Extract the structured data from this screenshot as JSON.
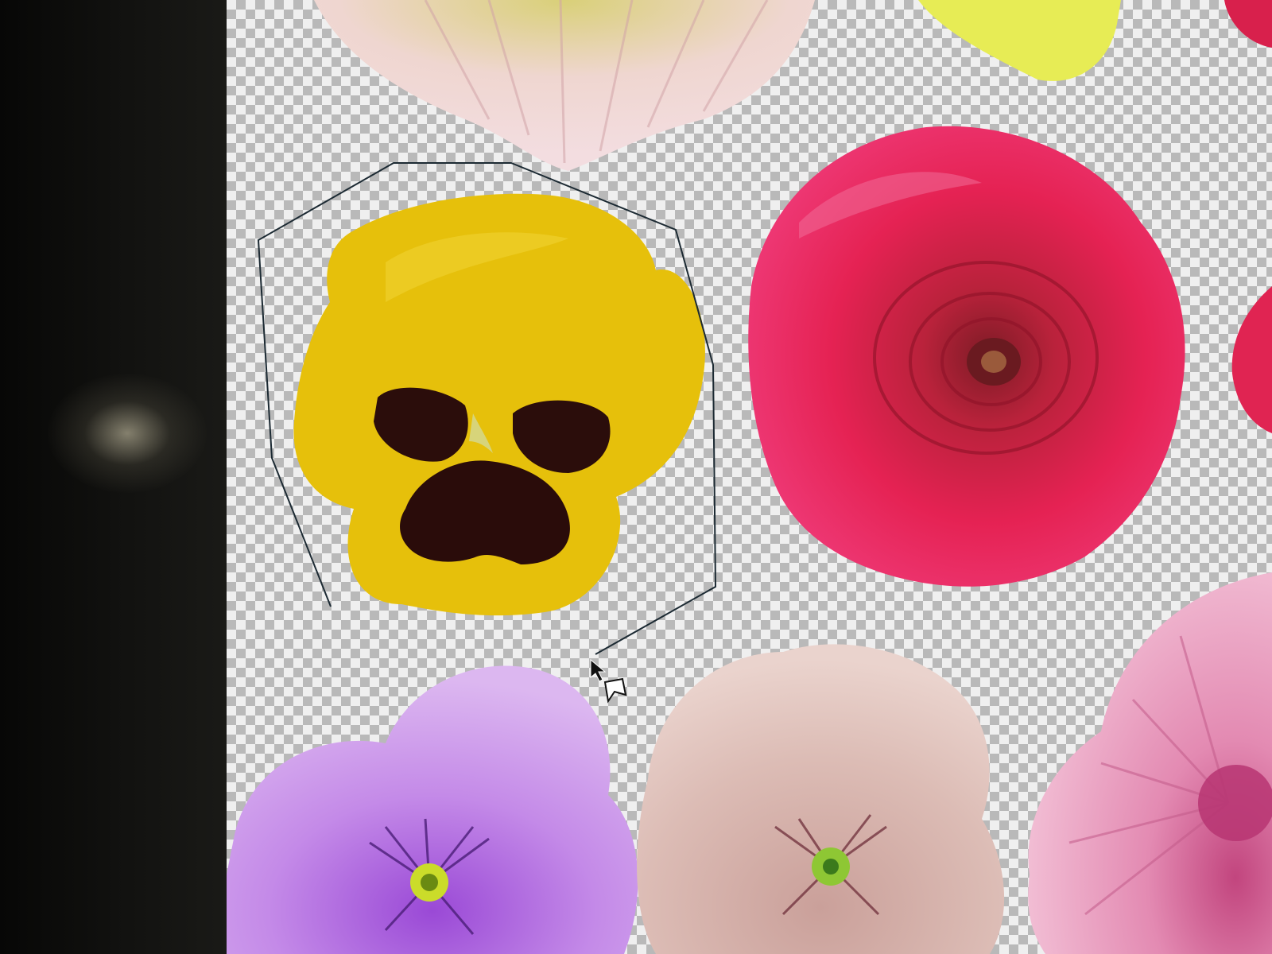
{
  "screen": {
    "description_kind": "image-editor canvas with transparency checkerboard",
    "tool": "polygonal-lasso"
  },
  "colors": {
    "checker_light": "#efefef",
    "checker_dark": "#b9b9b9",
    "bezel": "#0b0b0a",
    "yellow_pansy": "#e9c20a",
    "pansy_blotch": "#2a0d0a",
    "ranunculus": "#e8245e",
    "violet_pansy": "#c58de8",
    "blush_pansy": "#ddbdb6",
    "gerbera_pink": "#e592b6",
    "chrysanthemum": "#efc9cf",
    "lasso_line": "#1c2a33"
  },
  "icons": {
    "cursor": "polygonal-lasso-cursor-icon"
  }
}
